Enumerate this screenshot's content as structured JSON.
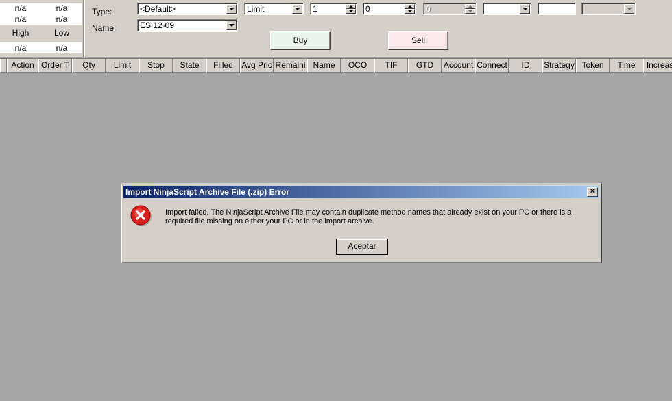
{
  "quote": {
    "row1": [
      "n/a",
      "n/a"
    ],
    "row2": [
      "n/a",
      "n/a"
    ],
    "high_label": "High",
    "low_label": "Low",
    "row3": [
      "n/a",
      "n/a"
    ]
  },
  "order_entry": {
    "type_label": "Type:",
    "name_label": "Name:",
    "type_value": "<Default>",
    "name_value": "ES 12-09",
    "order_type_value": "Limit",
    "quantity_value": "1",
    "limit_price_value": "0",
    "stop_price_value": "0",
    "tif_value": "",
    "text_value": "",
    "account_value": "",
    "buy_label": "Buy",
    "sell_label": "Sell",
    "buy_color": "#eaf5ea",
    "sell_color": "#fbe8ec"
  },
  "orders_grid": {
    "columns": [
      "",
      "Action",
      "Order T",
      "Qty",
      "Limit",
      "Stop",
      "State",
      "Filled",
      "Avg Pric",
      "Remaini",
      "Name",
      "OCO",
      "TIF",
      "GTD",
      "Account",
      "Connect",
      "ID",
      "Strategy",
      "Token",
      "Time",
      "Increas"
    ]
  },
  "dialog": {
    "title": "Import NinjaScript Archive File (.zip) Error",
    "close_glyph": "×",
    "message": "Import failed. The NinjaScript Archive File may contain duplicate method names that already exist on your PC or there is a required file missing on either your PC or in the import archive.",
    "ok_label": "Aceptar",
    "icon": "error-icon"
  },
  "colors": {
    "workspace": "#a5a5a5",
    "face": "#d4d0c8",
    "title_start": "#0a246a",
    "title_end": "#a6caf0",
    "error_red": "#d8201c"
  }
}
